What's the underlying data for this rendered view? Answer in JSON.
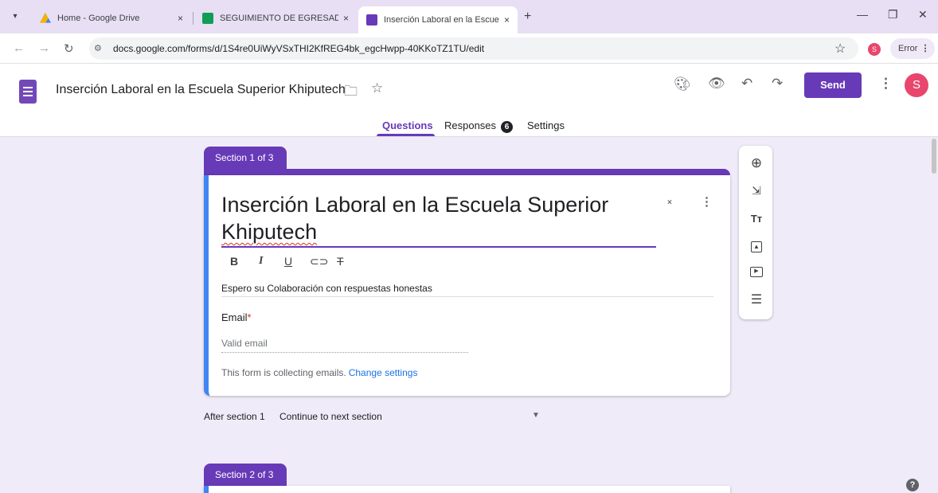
{
  "browser": {
    "tabs": [
      {
        "label": "Home - Google Drive",
        "close": "×"
      },
      {
        "label": "SEGUIMIENTO DE EGRESADOS",
        "close": "×"
      },
      {
        "label": "Inserción Laboral en la Escuela S",
        "close": "×"
      }
    ],
    "new_tab": "+",
    "url": "docs.google.com/forms/d/1S4re0UiWyVSxTHI2KfREG4bk_egcHwpp-40KKoTZ1TU/edit",
    "profile_initial": "S",
    "error_label": "Error"
  },
  "header": {
    "title": "Inserción Laboral en la Escuela Superior Khiputech",
    "send_label": "Send",
    "avatar_initial": "S",
    "tabs": {
      "questions": "Questions",
      "responses": "Responses",
      "responses_count": "6",
      "settings": "Settings"
    }
  },
  "section1": {
    "tag": "Section 1 of 3",
    "title_part1": "Inserción Laboral en la Escuela Superior",
    "title_part2": "Khiputech",
    "description": "Espero su Colaboración con respuestas honestas",
    "email_label": "Email",
    "required_mark": "*",
    "email_placeholder": "Valid email",
    "collecting_note": "This form is collecting emails.",
    "change_settings": "Change settings"
  },
  "after_section": {
    "label": "After section 1",
    "value": "Continue to next section"
  },
  "section2": {
    "tag": "Section 2 of 3"
  },
  "colors": {
    "accent": "#673ab7",
    "background": "#f0ebf8",
    "card_side": "#4285f4",
    "link": "#1a73e8",
    "required": "#d93025"
  },
  "icons": [
    "palette-icon",
    "preview-eye-icon",
    "undo-icon",
    "redo-icon",
    "more-vert-icon",
    "folder-icon",
    "star-icon",
    "add-question-icon",
    "import-questions-icon",
    "add-title-icon",
    "add-image-icon",
    "add-video-icon",
    "add-section-icon",
    "help-icon"
  ]
}
